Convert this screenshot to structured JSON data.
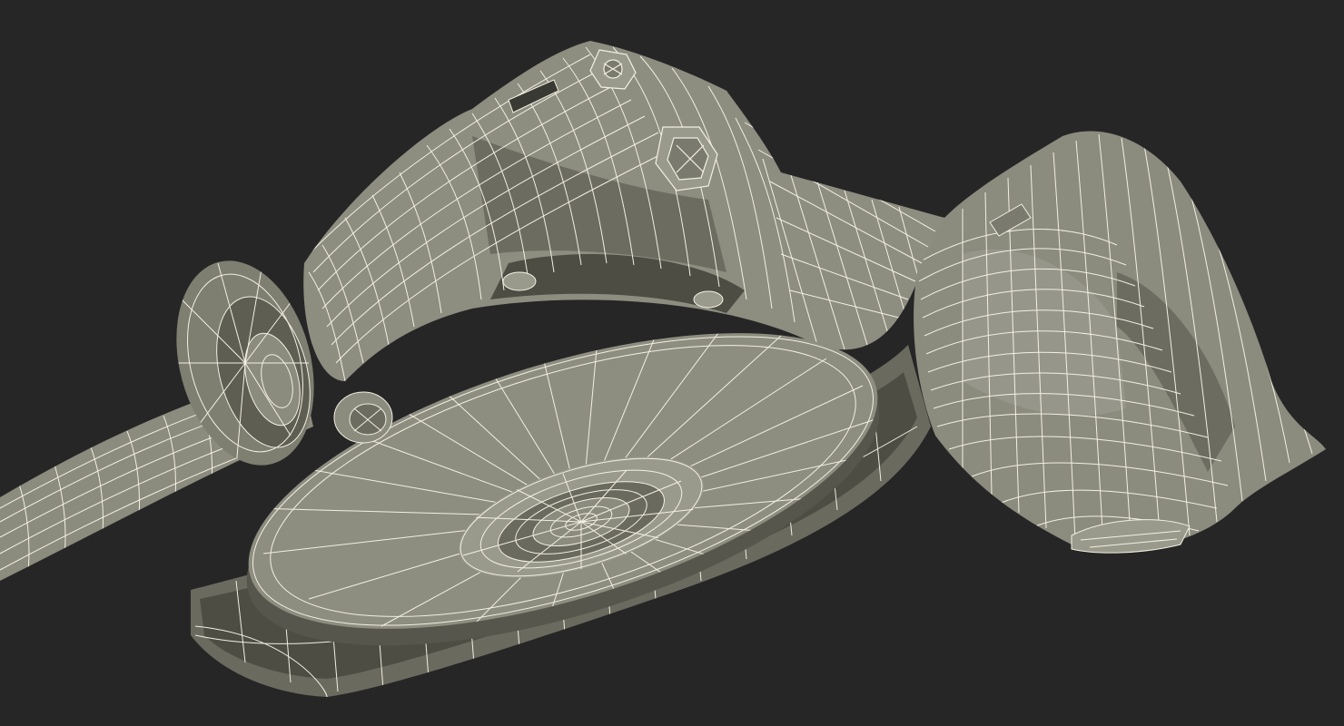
{
  "scene": {
    "subject": "angle-grinder-wireframe",
    "colors": {
      "background": "#262626",
      "surface": "#8a8a7c",
      "surface_light": "#a3a395",
      "surface_dark": "#5e5e53",
      "shadow": "#3a3a34",
      "wire": "#f3f0e2"
    }
  }
}
